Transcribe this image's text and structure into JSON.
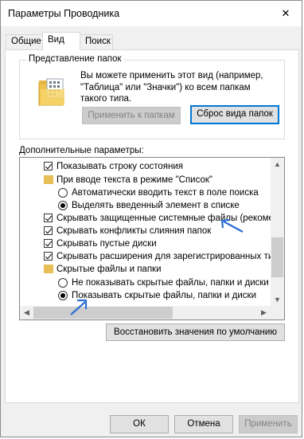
{
  "window": {
    "title": "Параметры Проводника",
    "close_glyph": "✕"
  },
  "tabs": [
    {
      "label": "Общие",
      "active": false
    },
    {
      "label": "Вид",
      "active": true
    },
    {
      "label": "Поиск",
      "active": false
    }
  ],
  "folder_views": {
    "title": "Представление папок",
    "description": "Вы можете применить этот вид (например, \"Таблица\" или \"Значки\") ко всем папкам такого типа.",
    "apply_button": "Применить к папкам",
    "reset_button": "Сброс вида папок"
  },
  "advanced": {
    "label": "Дополнительные параметры:",
    "items": [
      {
        "type": "checkbox",
        "checked": true,
        "indent": 1,
        "text": "Показывать строку состояния"
      },
      {
        "type": "folder",
        "indent": 1,
        "text": "При вводе текста в режиме \"Список\""
      },
      {
        "type": "radio",
        "selected": false,
        "indent": 2,
        "text": "Автоматически вводить текст в поле поиска"
      },
      {
        "type": "radio",
        "selected": true,
        "indent": 2,
        "text": "Выделять введенный элемент в списке"
      },
      {
        "type": "checkbox",
        "checked": true,
        "indent": 1,
        "text": "Скрывать защищенные системные файлы (рекомен"
      },
      {
        "type": "checkbox",
        "checked": true,
        "indent": 1,
        "text": "Скрывать конфликты слияния папок"
      },
      {
        "type": "checkbox",
        "checked": true,
        "indent": 1,
        "text": "Скрывать пустые диски"
      },
      {
        "type": "checkbox",
        "checked": true,
        "indent": 1,
        "text": "Скрывать расширения для зарегистрированных типо"
      },
      {
        "type": "folder",
        "indent": 1,
        "text": "Скрытые файлы и папки"
      },
      {
        "type": "radio",
        "selected": false,
        "indent": 2,
        "text": "Не показывать скрытые файлы, папки и диски"
      },
      {
        "type": "radio",
        "selected": true,
        "indent": 2,
        "text": "Показывать скрытые файлы, папки и диски"
      }
    ],
    "restore_button": "Восстановить значения по умолчанию"
  },
  "dialog_buttons": {
    "ok": "ОК",
    "cancel": "Отмена",
    "apply": "Применить"
  },
  "colors": {
    "accent": "#0078d7",
    "folder": "#e8bf57",
    "annotation_arrow": "#2a6fd6"
  }
}
